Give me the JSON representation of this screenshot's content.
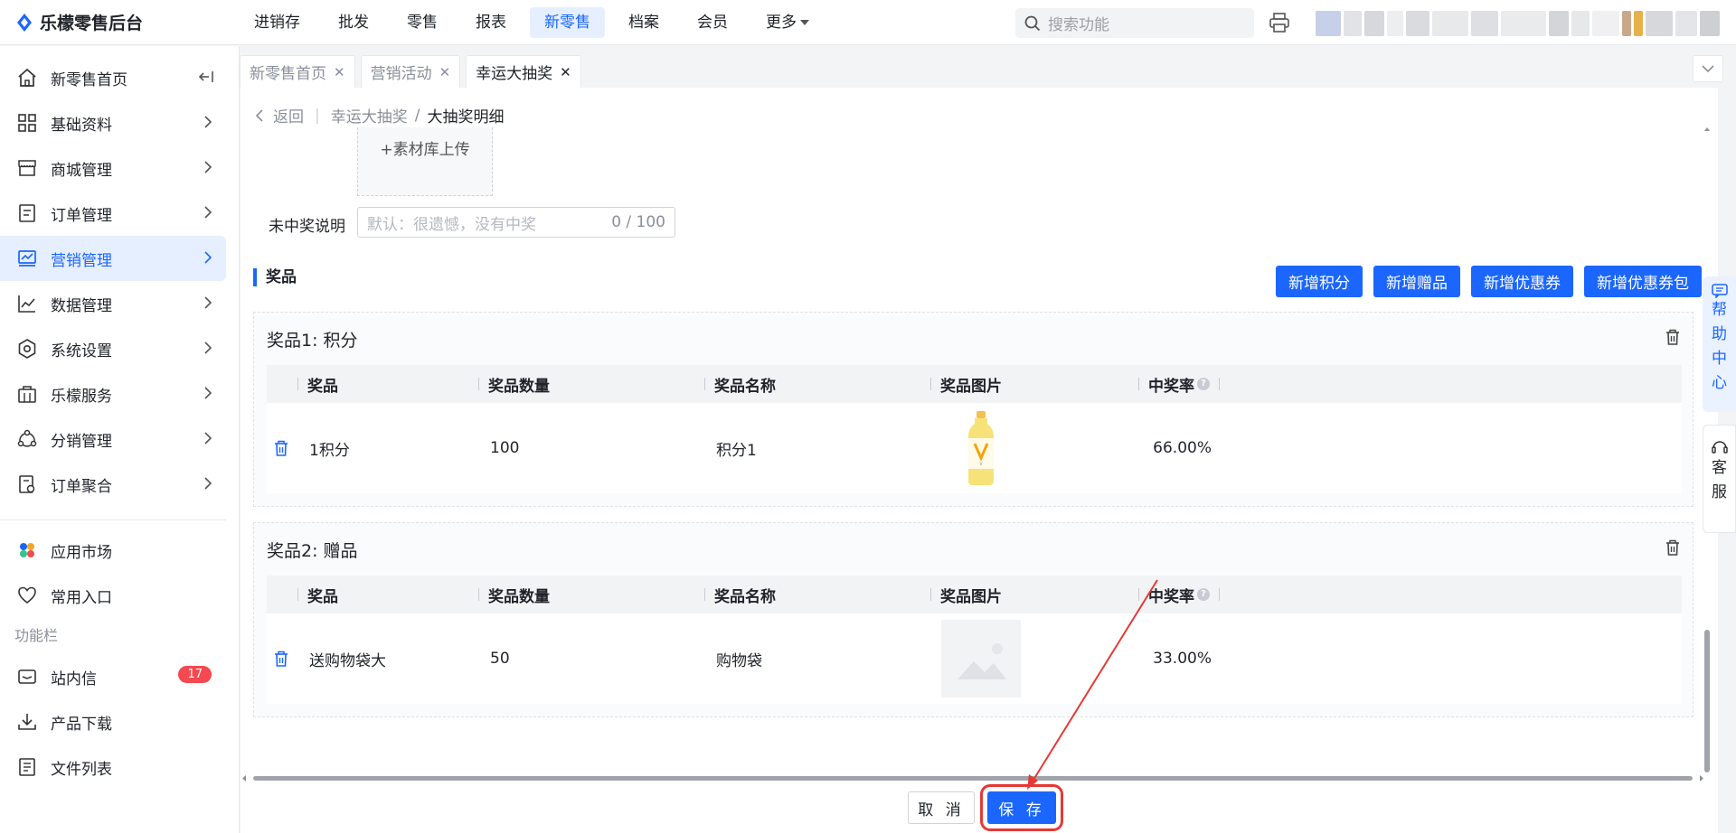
{
  "app": {
    "title": "乐檬零售后台"
  },
  "topnav": {
    "items": [
      "进销存",
      "批发",
      "零售",
      "报表",
      "新零售",
      "档案",
      "会员",
      "更多"
    ],
    "active_index": 4
  },
  "search": {
    "placeholder": "搜索功能"
  },
  "sidebar": {
    "items": [
      {
        "label": "新零售首页",
        "icon": "home-icon"
      },
      {
        "label": "基础资料",
        "icon": "grid-icon"
      },
      {
        "label": "商城管理",
        "icon": "store-icon"
      },
      {
        "label": "订单管理",
        "icon": "order-icon"
      },
      {
        "label": "营销管理",
        "icon": "marketing-icon"
      },
      {
        "label": "数据管理",
        "icon": "chart-icon"
      },
      {
        "label": "系统设置",
        "icon": "settings-icon"
      },
      {
        "label": "乐檬服务",
        "icon": "service-icon"
      },
      {
        "label": "分销管理",
        "icon": "distribution-icon"
      },
      {
        "label": "订单聚合",
        "icon": "aggregate-icon"
      }
    ],
    "active_index": 4,
    "bottom": [
      {
        "label": "应用市场",
        "icon": "app-market-icon"
      },
      {
        "label": "常用入口",
        "icon": "heart-icon"
      }
    ],
    "func_title": "功能栏",
    "func_items": [
      {
        "label": "站内信",
        "icon": "mail-icon",
        "badge": "17"
      },
      {
        "label": "产品下载",
        "icon": "download-icon"
      },
      {
        "label": "文件列表",
        "icon": "file-list-icon"
      }
    ]
  },
  "tabs": [
    {
      "label": "新零售首页"
    },
    {
      "label": "营销活动"
    },
    {
      "label": "幸运大抽奖"
    }
  ],
  "tabs_active_index": 2,
  "breadcrumb": {
    "back": "返回",
    "parent": "幸运大抽奖",
    "current": "大抽奖明细"
  },
  "upload": {
    "label": "+素材库上传"
  },
  "no_prize": {
    "label": "未中奖说明",
    "placeholder": "默认：很遗憾，没有中奖",
    "counter": "0 / 100"
  },
  "prizes_section": {
    "title": "奖品",
    "buttons": [
      "新增积分",
      "新增赠品",
      "新增优惠券",
      "新增优惠券包"
    ]
  },
  "table_headers": [
    "奖品",
    "奖品数量",
    "奖品名称",
    "奖品图片",
    "中奖率"
  ],
  "prizes": [
    {
      "title": "奖品1: 积分",
      "name": "1积分",
      "quantity": "100",
      "prize_name": "积分1",
      "image": "juice-bottle",
      "rate": "66.00%"
    },
    {
      "title": "奖品2: 赠品",
      "name": "送购物袋大",
      "quantity": "50",
      "prize_name": "购物袋",
      "image": "placeholder",
      "rate": "33.00%"
    }
  ],
  "footer": {
    "cancel": "取 消",
    "save": "保 存"
  },
  "help": {
    "label": [
      "帮",
      "助",
      "中",
      "心"
    ]
  },
  "customer_service": {
    "label": [
      "客",
      "服"
    ]
  },
  "colors": {
    "primary": "#1a66ff",
    "annotation": "#e53935",
    "badge": "#f5484f"
  }
}
